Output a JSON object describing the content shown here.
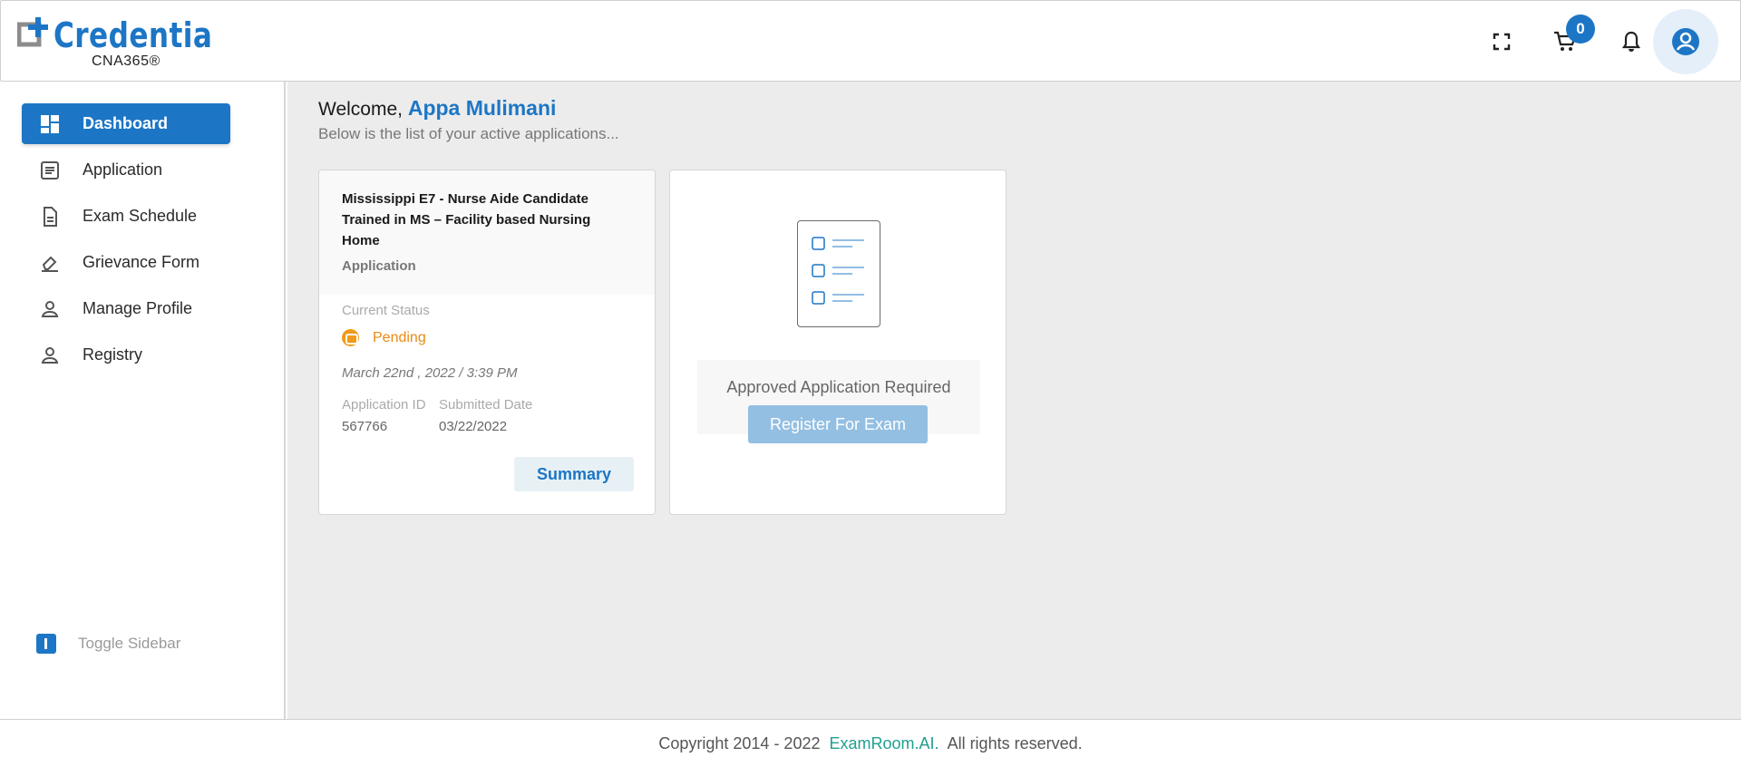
{
  "header": {
    "logo_name": "Credentia",
    "logo_sub": "CNA365®",
    "cart_count": "0",
    "icons": [
      "fullscreen-icon",
      "cart-icon",
      "bell-icon",
      "account-icon"
    ]
  },
  "sidebar": {
    "items": [
      {
        "label": "Dashboard",
        "icon": "dashboard-icon",
        "active": true
      },
      {
        "label": "Application",
        "icon": "application-icon"
      },
      {
        "label": "Exam Schedule",
        "icon": "document-icon"
      },
      {
        "label": "Grievance Form",
        "icon": "eraser-icon"
      },
      {
        "label": "Manage Profile",
        "icon": "person-icon"
      },
      {
        "label": "Registry",
        "icon": "person-icon"
      }
    ],
    "toggle_label": "Toggle Sidebar"
  },
  "main": {
    "welcome_prefix": "Welcome,",
    "user_name": "Appa Mulimani",
    "subtitle": "Below is the list of your active applications...",
    "application_card": {
      "title": "Mississippi E7 - Nurse Aide Candidate Trained in MS – Facility based Nursing Home",
      "type": "Application",
      "status_label": "Current Status",
      "status": "Pending",
      "date_time": "March 22nd , 2022 / 3:39 PM",
      "app_id_label": "Application ID",
      "app_id": "567766",
      "submitted_label": "Submitted Date",
      "submitted_date": "03/22/2022",
      "summary_button": "Summary"
    },
    "exam_card": {
      "message": "Approved Application Required",
      "register_button": "Register For Exam"
    }
  },
  "footer": {
    "copyright": "Copyright 2014 - 2022",
    "brand": "ExamRoom.AI.",
    "rights": "All rights reserved."
  },
  "colors": {
    "primary": "#1d76c5",
    "pending": "#e88b10",
    "footer_brand": "#1fa08f"
  }
}
